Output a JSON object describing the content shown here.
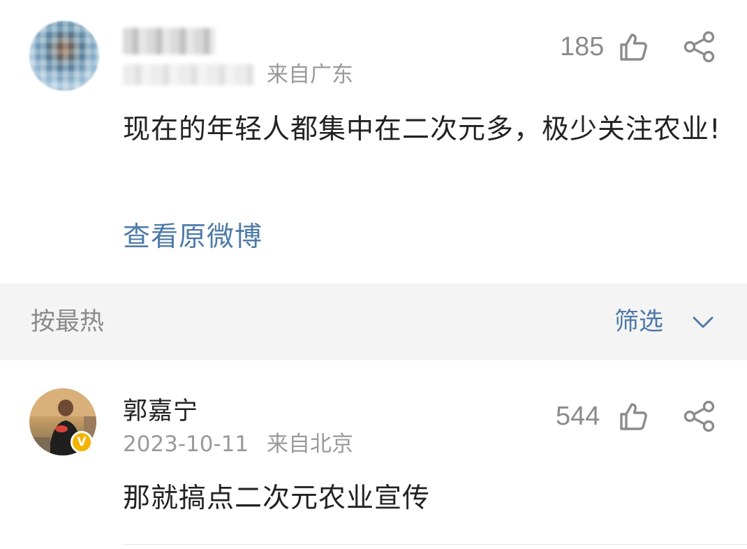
{
  "top_comment": {
    "location": "来自广东",
    "like_count": "185",
    "content": "现在的年轻人都集中在二次元多，极少关注农业!",
    "view_original_label": "查看原微博"
  },
  "sort_bar": {
    "sort_label": "按最热",
    "filter_label": "筛选"
  },
  "reply": {
    "username": "郭嘉宁",
    "date": "2023-10-11",
    "location": "来自北京",
    "like_count": "544",
    "content": "那就搞点二次元农业宣传",
    "badge": "V"
  },
  "colors": {
    "link": "#4e7aa8",
    "muted": "#9a9a9a",
    "badge": "#f4b400",
    "sort_bg": "#f4f4f4"
  },
  "icons": [
    "like-thumb-icon",
    "share-icon",
    "chevron-down-icon",
    "verified-badge-icon"
  ]
}
